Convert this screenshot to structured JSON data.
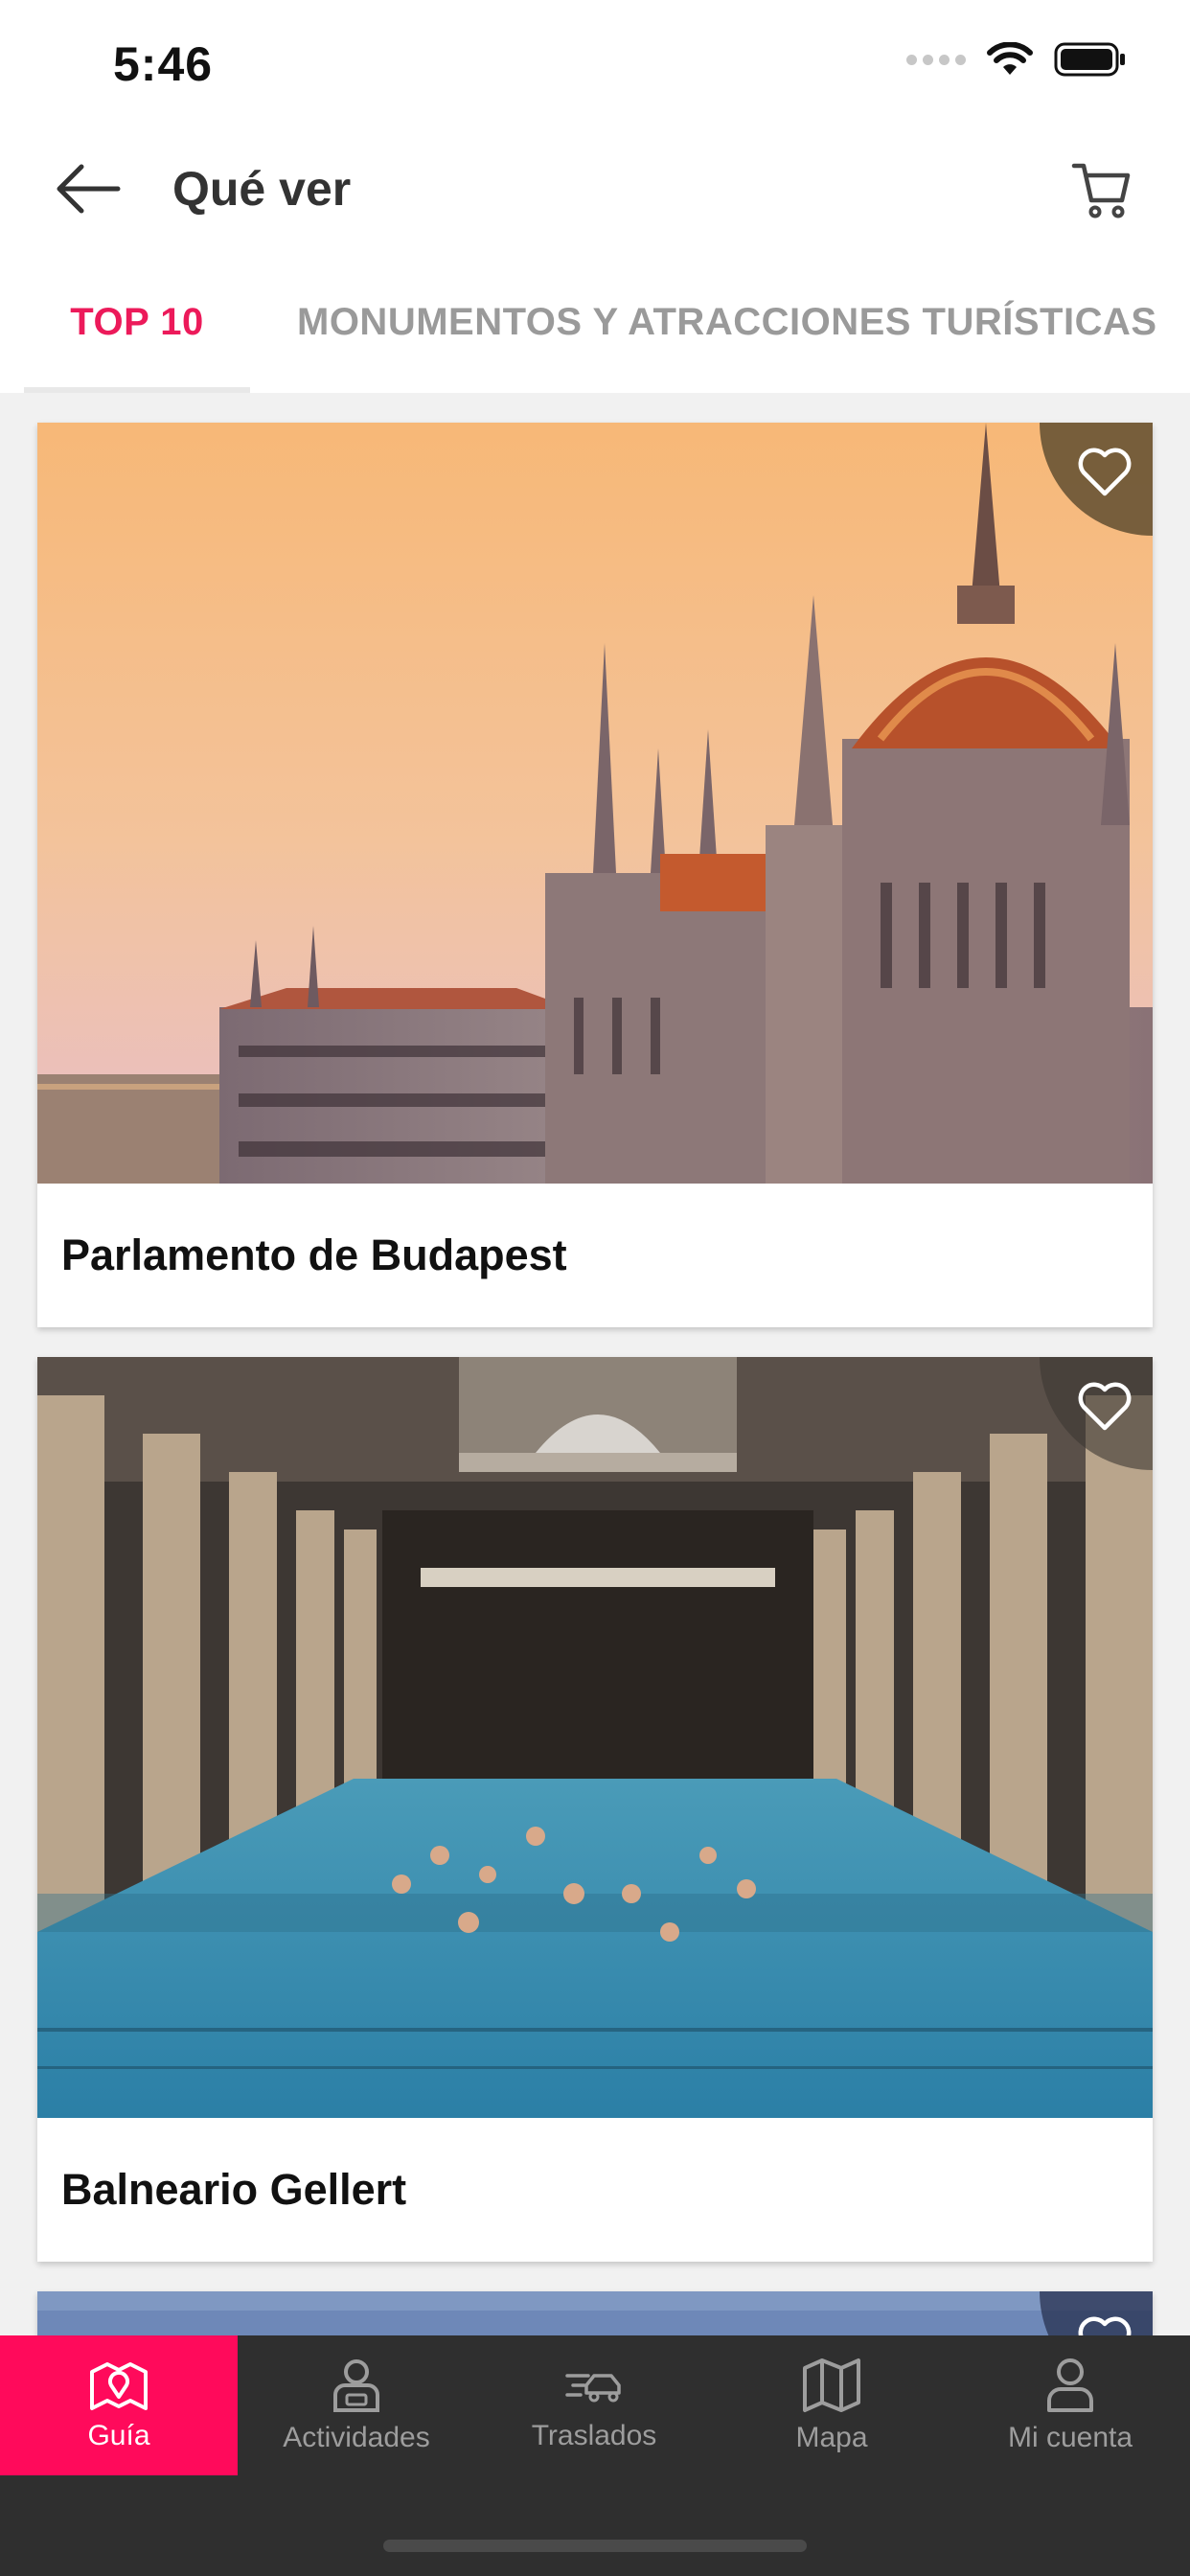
{
  "status_bar": {
    "time": "5:46"
  },
  "header": {
    "title": "Qué ver"
  },
  "tabs": [
    {
      "label": "TOP 10",
      "active": true
    },
    {
      "label": "MONUMENTOS Y ATRACCIONES TURÍSTICAS",
      "active": false
    }
  ],
  "cards": [
    {
      "title": "Parlamento de Budapest",
      "image": "hungarian-parliament-building-photo"
    },
    {
      "title": "Balneario Gellert",
      "image": "gellert-bath-indoor-pool-photo"
    },
    {
      "title": "",
      "image": "sky-photo-partial"
    }
  ],
  "bottom_nav": [
    {
      "label": "Guía",
      "icon": "map-pin-icon",
      "active": true
    },
    {
      "label": "Actividades",
      "icon": "ticket-person-icon",
      "active": false
    },
    {
      "label": "Traslados",
      "icon": "car-transfer-icon",
      "active": false
    },
    {
      "label": "Mapa",
      "icon": "folded-map-icon",
      "active": false
    },
    {
      "label": "Mi cuenta",
      "icon": "user-icon",
      "active": false
    }
  ],
  "colors": {
    "accent": "#ec1a5a",
    "nav_active": "#ff0a5b",
    "nav_bg": "#2f2f2f",
    "content_bg": "#f1f1f1"
  }
}
